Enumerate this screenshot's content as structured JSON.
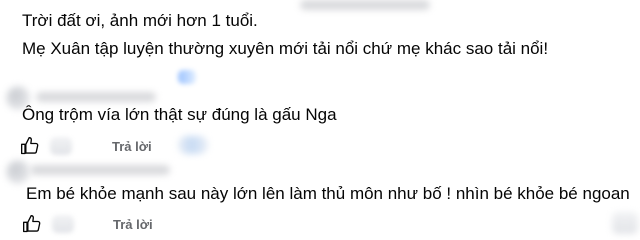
{
  "comments": [
    {
      "lines": [
        "Trời đất ơi, ảnh mới hơn 1 tuổi.",
        "Mẹ Xuân tập luyện thường xuyên mới tải nổi chứ mẹ khác sao tải nổi!"
      ]
    },
    {
      "lines": [
        "Ông trộm vía lớn thật sự đúng là gấu Nga"
      ],
      "reply_label": "Trả lời"
    },
    {
      "lines": [
        "Em bé khỏe mạnh sau này lớn lên làm thủ môn như bố ! nhìn bé khỏe bé ngoan"
      ],
      "reply_label": "Trả lời"
    }
  ],
  "icons": {
    "like": "thumbs-up-icon"
  },
  "colors": {
    "text": "#050505",
    "secondary": "#65676b",
    "redacted": "#d9dadd"
  }
}
